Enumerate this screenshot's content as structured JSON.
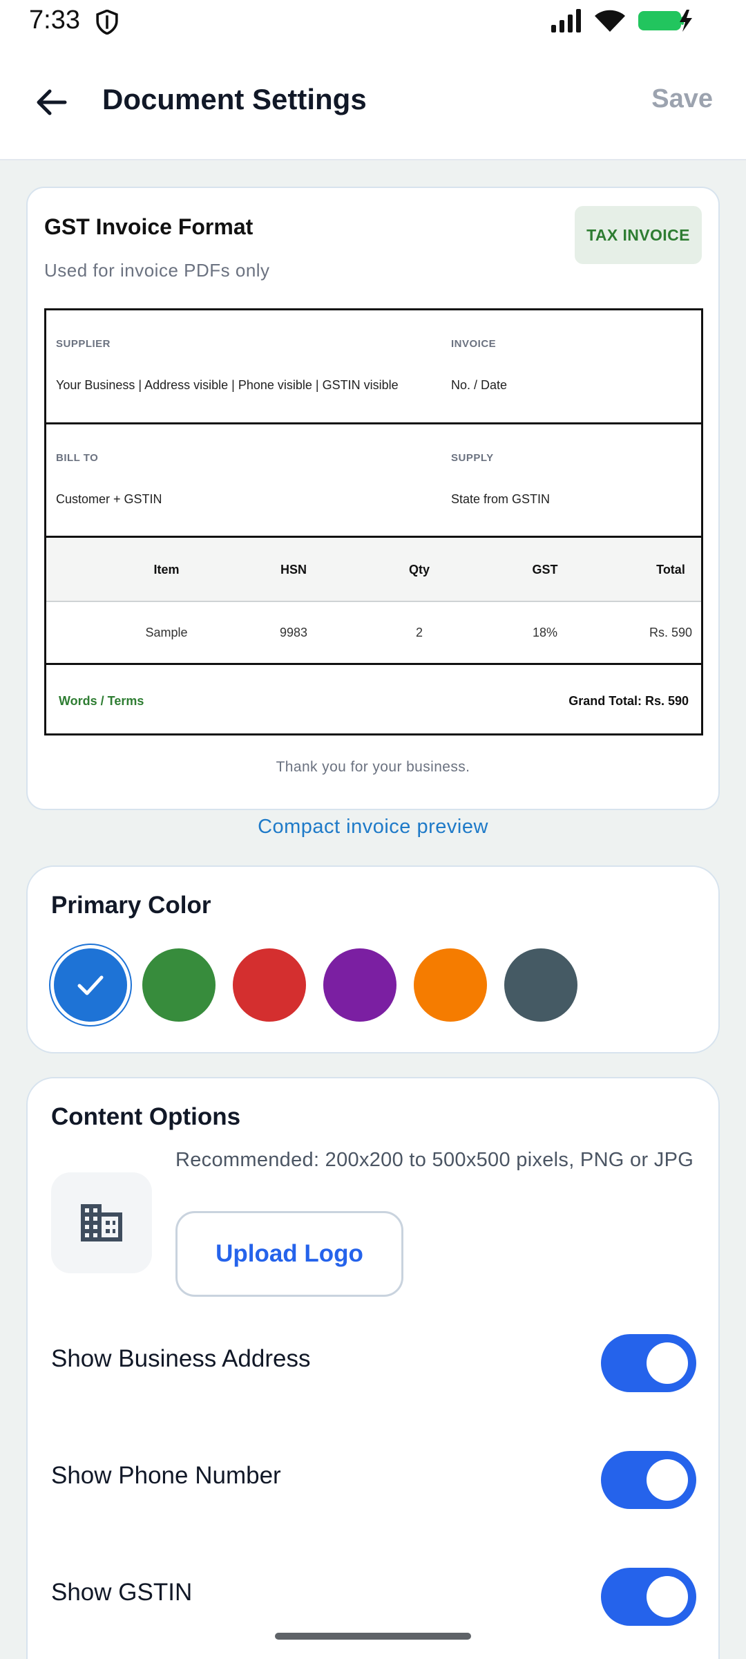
{
  "status_bar": {
    "time": "7:33"
  },
  "app_bar": {
    "title": "Document Settings",
    "save_label": "Save"
  },
  "preview": {
    "title": "GST Invoice Format",
    "subtitle": "Used for invoice PDFs only",
    "badge": "TAX INVOICE",
    "invoice": {
      "supplier_caption": "SUPPLIER",
      "supplier_value": "Your Business | Address visible | Phone visible | GSTIN visible",
      "invoice_caption": "INVOICE",
      "invoice_value": "No. / Date",
      "bill_to_caption": "BILL TO",
      "bill_to_value": "Customer + GSTIN",
      "supply_caption": "SUPPLY",
      "supply_value": "State from GSTIN",
      "headers": [
        "Item",
        "HSN",
        "Qty",
        "GST",
        "Total"
      ],
      "row": [
        "Sample",
        "9983",
        "2",
        "18%",
        "Rs. 590"
      ],
      "words_terms": "Words / Terms",
      "grand_total": "Grand Total: Rs. 590"
    },
    "footer_note": "Thank you for your business.",
    "link_label": "Compact invoice preview"
  },
  "primary_color": {
    "title": "Primary Color",
    "swatches": [
      {
        "name": "blue",
        "color": "#1e73d6",
        "selected": true
      },
      {
        "name": "green",
        "color": "#378c3c",
        "selected": false
      },
      {
        "name": "red",
        "color": "#d42f2f",
        "selected": false
      },
      {
        "name": "purple",
        "color": "#7b1fa2",
        "selected": false
      },
      {
        "name": "orange",
        "color": "#f57c00",
        "selected": false
      },
      {
        "name": "slate",
        "color": "#455a64",
        "selected": false
      }
    ]
  },
  "content_options": {
    "title": "Content Options",
    "logo_icon": "building-icon",
    "recommendation": "Recommended: 200x200 to 500x500 pixels, PNG or JPG",
    "upload_label": "Upload Logo",
    "toggles": [
      {
        "label": "Show Business Address",
        "on": true
      },
      {
        "label": "Show Phone Number",
        "on": true
      },
      {
        "label": "Show GSTIN",
        "on": true
      }
    ]
  },
  "colors": {
    "accent": "#2563eb",
    "link": "#1e7ac8",
    "badge_text": "#2e7d32",
    "badge_bg": "#e6efe7"
  }
}
